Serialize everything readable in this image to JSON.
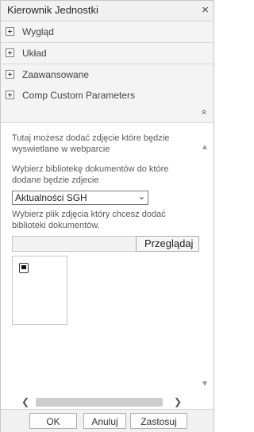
{
  "panel": {
    "title": "Kierownik Jednostki",
    "close_glyph": "×",
    "collapse_glyph": "»"
  },
  "sections": [
    {
      "label": "Wygląd"
    },
    {
      "label": "Układ"
    },
    {
      "label": "Zaawansowane"
    },
    {
      "label": "Comp Custom Parameters"
    }
  ],
  "content": {
    "intro_line1": "Tutaj możesz dodać zdjęcie które będzie",
    "intro_line2": "wyswietlane w webparcie",
    "library_prompt_line1": "Wybierz bibliotekę dokumentów do które",
    "library_prompt_line2": "dodane będzie zdjecie",
    "library_select_value": "Aktualności SGH",
    "file_prompt_line1": "Wybierz plik zdjęcia który chcesz dodać",
    "file_prompt_line2": "biblioteki dokumentów.",
    "browse_label": "Przeglądaj"
  },
  "scroll": {
    "up_glyph": "▲",
    "down_glyph": "▼",
    "left_glyph": "❮",
    "right_glyph": "❯"
  },
  "footer": {
    "ok_label": "OK",
    "cancel_label": "Anuluj",
    "apply_label": "Zastosuj"
  },
  "colors": {
    "header_bg": "#f1f1f1",
    "section_bg": "#f4f4f4",
    "border": "#c6c6c6",
    "text": "#444444"
  }
}
